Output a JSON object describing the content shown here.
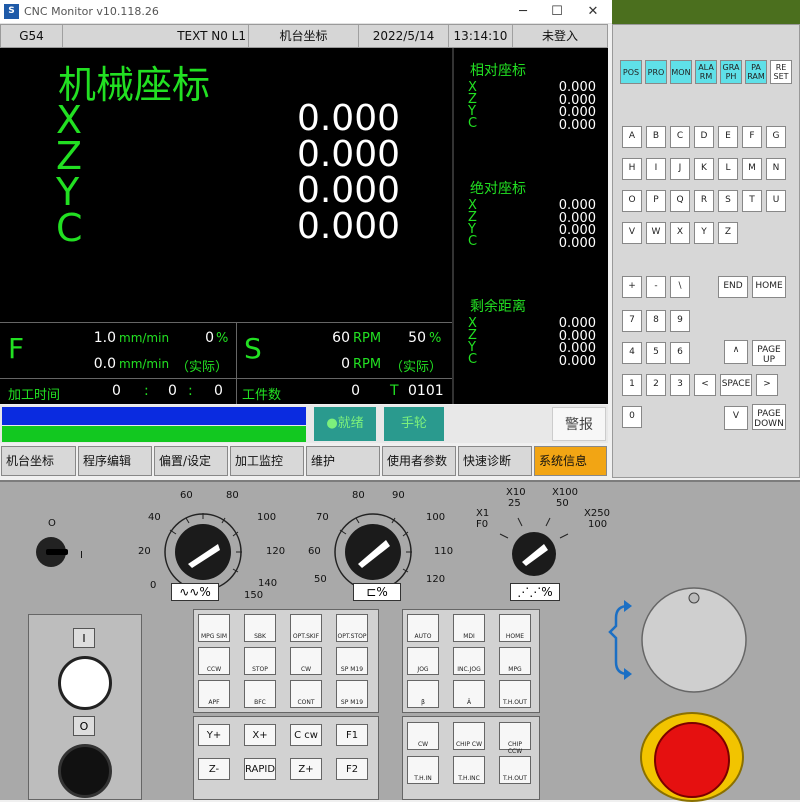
{
  "window": {
    "title": "CNC Monitor v10.118.26",
    "icon": "S",
    "minimize": "─",
    "maximize": "☐",
    "close": "✕"
  },
  "status_bar": {
    "coord_sys": "G54",
    "program": "TEXT N0 L1",
    "screen_name": "机台坐标",
    "date": "2022/5/14",
    "time": "13:14:10",
    "login": "未登入"
  },
  "machine_coords": {
    "title": "机械座标",
    "axes": [
      {
        "name": "X",
        "value": "0.000"
      },
      {
        "name": "Z",
        "value": "0.000"
      },
      {
        "name": "Y",
        "value": "0.000"
      },
      {
        "name": "C",
        "value": "0.000"
      }
    ]
  },
  "side_coords": [
    {
      "title": "相对座标",
      "axes": [
        "X",
        "Z",
        "Y",
        "C"
      ],
      "values": [
        "0.000",
        "0.000",
        "0.000",
        "0.000"
      ]
    },
    {
      "title": "绝对座标",
      "axes": [
        "X",
        "Z",
        "Y",
        "C"
      ],
      "values": [
        "0.000",
        "0.000",
        "0.000",
        "0.000"
      ]
    },
    {
      "title": "剩余距离",
      "axes": [
        "X",
        "Z",
        "Y",
        "C"
      ],
      "values": [
        "0.000",
        "0.000",
        "0.000",
        "0.000"
      ]
    }
  ],
  "feed": {
    "label": "F",
    "set_value": "1.0",
    "set_unit": "mm/min",
    "override": "0",
    "override_unit": "%",
    "actual_value": "0.0",
    "actual_unit": "mm/min",
    "actual_label": "（实际）"
  },
  "spindle": {
    "label": "S",
    "set_value": "60",
    "set_unit": "RPM",
    "override": "50",
    "override_unit": "%",
    "actual_value": "0",
    "actual_unit": "RPM",
    "actual_label": "（实际）"
  },
  "machining": {
    "time_label": "加工时间",
    "h": "0",
    "m": "0",
    "s": "0",
    "sep": ":",
    "count_label": "工件数",
    "count": "0",
    "tool_label": "T",
    "tool": "0101"
  },
  "status": {
    "ready": "●就绪",
    "handwheel": "手轮",
    "alarm": "警报"
  },
  "colors": {
    "screen_bg": "#000000",
    "text_green": "#22e022",
    "progress_blue": "#0a2be0",
    "progress_green": "#12c820",
    "status_teal": "#2a9a8e",
    "menu_active": "#f2a514",
    "fkey_cyan": "#5fe0e8",
    "estop_red": "#e51010"
  },
  "menu": [
    {
      "label": "机台坐标"
    },
    {
      "label": "程序编辑"
    },
    {
      "label": "偏置/设定"
    },
    {
      "label": "加工监控"
    },
    {
      "label": "维护"
    },
    {
      "label": "使用者参数"
    },
    {
      "label": "快速诊断"
    },
    {
      "label": "系统信息"
    }
  ],
  "keypad": {
    "function_keys": [
      "POS",
      "PRO",
      "MON",
      "ALA RM",
      "GRA PH",
      "PA RAM",
      "RE SET"
    ],
    "letters": [
      "A",
      "B",
      "C",
      "D",
      "E",
      "F",
      "G",
      "H",
      "I",
      "J",
      "K",
      "L",
      "M",
      "N",
      "O",
      "P",
      "Q",
      "R",
      "S",
      "T",
      "U",
      "V",
      "W",
      "X",
      "Y",
      "Z"
    ],
    "symbols": [
      "+",
      "-",
      "\\"
    ],
    "end": "END",
    "home": "HOME",
    "digits": [
      "7",
      "8",
      "9",
      "4",
      "5",
      "6",
      "1",
      "2",
      "3",
      "0"
    ],
    "up": "∧",
    "down": "V",
    "left": "<",
    "right": ">",
    "space": "SPACE",
    "page_up": "PAGE UP",
    "page_down": "PAGE DOWN"
  },
  "panel": {
    "power_off": "O",
    "power_on": "I",
    "feed_dial_labels": [
      "0",
      "20",
      "40",
      "60",
      "80",
      "100",
      "120",
      "140",
      "150"
    ],
    "feed_dial_symbol": "∿∿%",
    "spindle_dial_labels": [
      "50",
      "60",
      "70",
      "80",
      "90",
      "100",
      "110",
      "120"
    ],
    "spindle_dial_symbol": "⊏%",
    "rate_dial_labels": [
      "X1",
      "F0",
      "X10",
      "25",
      "X100",
      "50",
      "X250",
      "100"
    ],
    "rate_dial_symbol": "⋰⋰%",
    "start_label": "I",
    "stop_label": "O",
    "mode_buttons_left": [
      "MPG SIM",
      "SBK",
      "OPT.SKIF",
      "OPT.STOP",
      "CCW",
      "STOP",
      "CW",
      "SP M19",
      "APF",
      "BFC",
      "CONT",
      "SP M19"
    ],
    "mode_buttons_right": [
      "AUTO",
      "MDI",
      "HOME",
      "JOG",
      "INC.JOG",
      "MPG",
      "β",
      "Â",
      "T.H.OUT"
    ],
    "axis_buttons": [
      "Y+",
      "X+",
      "C cw",
      "F1",
      "Z-",
      "RAPID",
      "Z+",
      "F2"
    ],
    "turret_buttons": [
      "CW",
      "CHIP CW",
      "CHIP CCW",
      "T.H.IN",
      "T.H.INC",
      "T.H.OUT"
    ]
  }
}
